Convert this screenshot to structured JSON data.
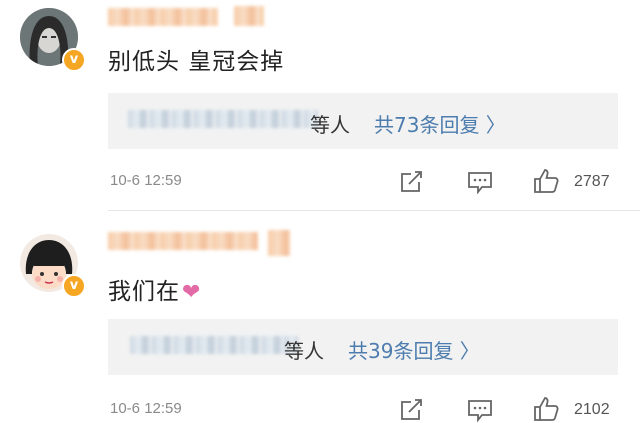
{
  "comments": [
    {
      "text": "别低头 皇冠会掉",
      "reply_prefix": "等人",
      "reply_count": "共73条回复 〉",
      "timestamp": "10-6 12:59",
      "likes": "2787",
      "verified_mark": "v"
    },
    {
      "text": "我们在",
      "emoji": "❤",
      "reply_prefix": "等人",
      "reply_count": "共39条回复 〉",
      "timestamp": "10-6 12:59",
      "likes": "2102",
      "verified_mark": "v"
    }
  ],
  "icons": [
    "share-icon",
    "comment-icon",
    "like-icon"
  ],
  "colors": {
    "accent": "#4d7cae",
    "verified": "#f5a623",
    "heart": "#e26aa6",
    "reply_bg": "#f2f2f2"
  }
}
